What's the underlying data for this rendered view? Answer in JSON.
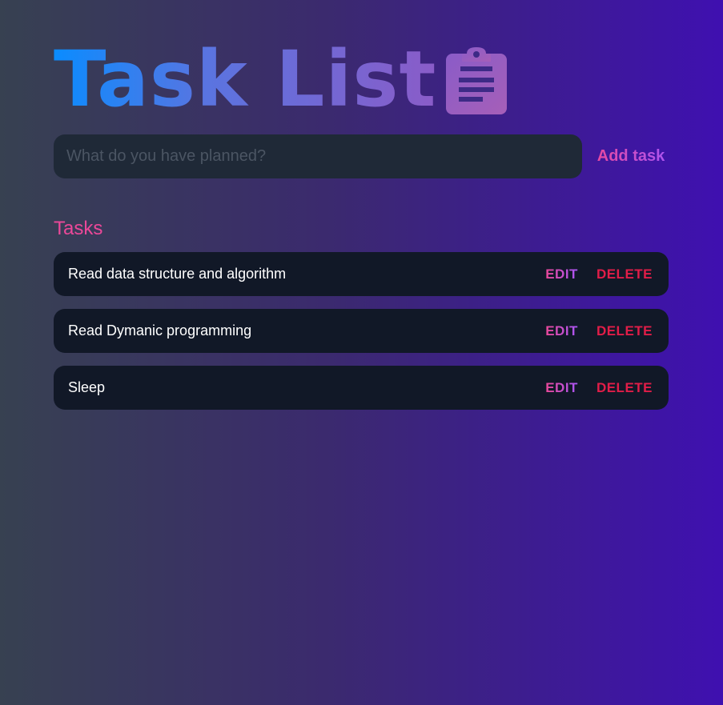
{
  "header": {
    "title": "Task List",
    "icon": "clipboard-list-icon"
  },
  "form": {
    "placeholder": "What do you have planned?",
    "value": "",
    "add_label": "Add task"
  },
  "tasks_section": {
    "heading": "Tasks",
    "items": [
      {
        "text": "Read data structure and algorithm",
        "edit_label": "EDIT",
        "delete_label": "DELETE"
      },
      {
        "text": "Read Dymanic programming",
        "edit_label": "EDIT",
        "delete_label": "DELETE"
      },
      {
        "text": "Sleep",
        "edit_label": "EDIT",
        "delete_label": "DELETE"
      }
    ]
  },
  "colors": {
    "background_start": "#374151",
    "background_end": "#3f10b0",
    "accent_pink": "#ec4899",
    "accent_purple": "#a855f7",
    "delete_red": "#e11d48",
    "card_bg": "#111827",
    "input_bg": "#1f2937"
  }
}
